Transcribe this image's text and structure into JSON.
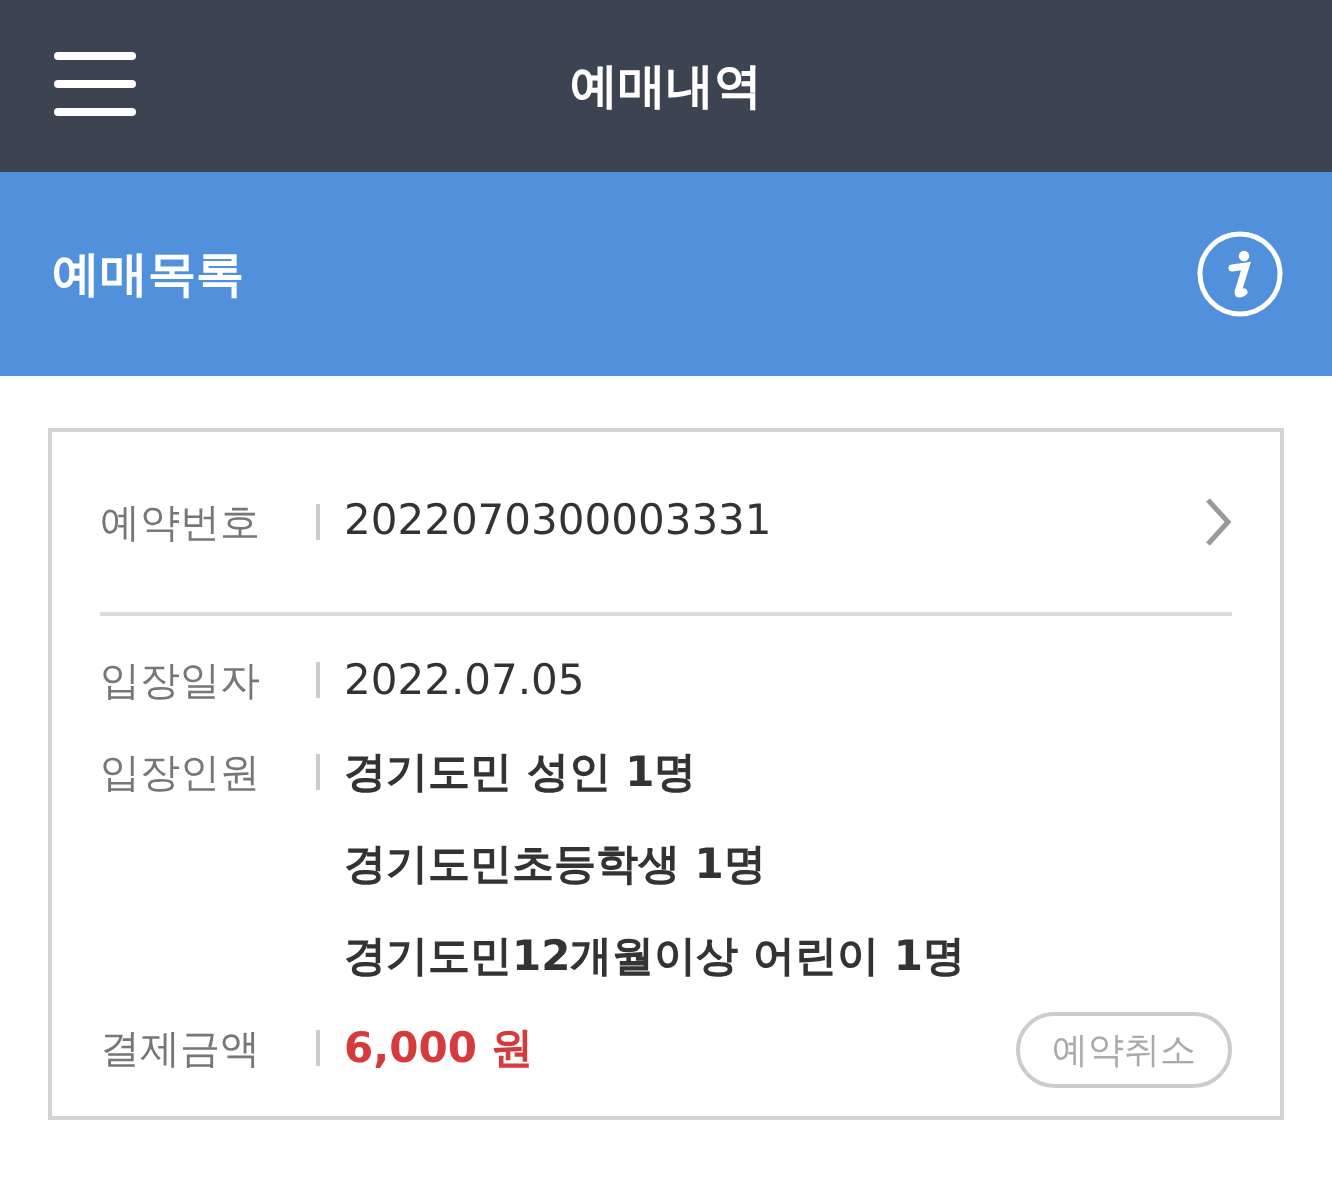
{
  "header": {
    "title": "예매내역"
  },
  "section": {
    "title": "예매목록"
  },
  "reservation": {
    "number_label": "예약번호",
    "number": "2022070300003331",
    "details": [
      {
        "kind": "plain",
        "label": "입장일자",
        "values": [
          "2022.07.05"
        ]
      },
      {
        "kind": "bold",
        "label": "입장인원",
        "values": [
          "경기도민 성인 1명",
          "경기도민초등학생 1명",
          "경기도민12개월이상 어린이 1명"
        ]
      },
      {
        "kind": "price",
        "label": "결제금액",
        "values": [
          "6,000 원"
        ]
      }
    ],
    "cancel_button": "예약취소"
  }
}
